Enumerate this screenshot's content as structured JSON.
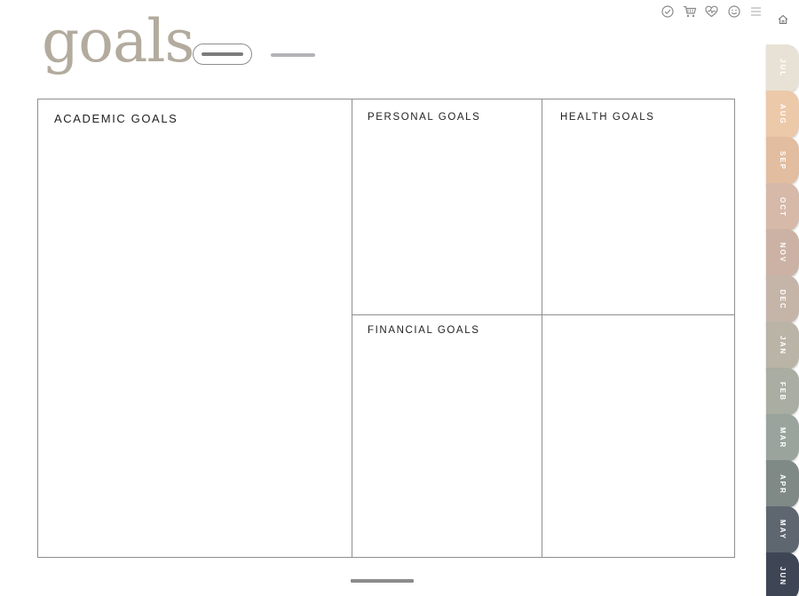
{
  "page": {
    "title": "goals"
  },
  "sections": {
    "academic": "ACADEMIC GOALS",
    "personal": "PERSONAL GOALS",
    "health": "HEALTH GOALS",
    "financial": "FINANCIAL GOALS"
  },
  "toolbar": {
    "icons": [
      "check-circle-icon",
      "cart-icon",
      "heart-pulse-icon",
      "smiley-icon",
      "menu-icon"
    ],
    "home_icon": "home-icon"
  },
  "tabs": [
    {
      "label": "JUL",
      "color": "#e8e2d6"
    },
    {
      "label": "AUG",
      "color": "#ecc9a9"
    },
    {
      "label": "SEP",
      "color": "#e2bda0"
    },
    {
      "label": "OCT",
      "color": "#d6b9a8"
    },
    {
      "label": "NOV",
      "color": "#ccb2a4"
    },
    {
      "label": "DEC",
      "color": "#c5b5a9"
    },
    {
      "label": "JAN",
      "color": "#b9b4a6"
    },
    {
      "label": "FEB",
      "color": "#a9ada2"
    },
    {
      "label": "MAR",
      "color": "#9aa49d"
    },
    {
      "label": "APR",
      "color": "#7f8a87"
    },
    {
      "label": "MAY",
      "color": "#5e6670"
    },
    {
      "label": "JUN",
      "color": "#3e4656"
    }
  ],
  "colors": {
    "title": "#b2ab9e",
    "grid_line": "#8e8e8e"
  }
}
